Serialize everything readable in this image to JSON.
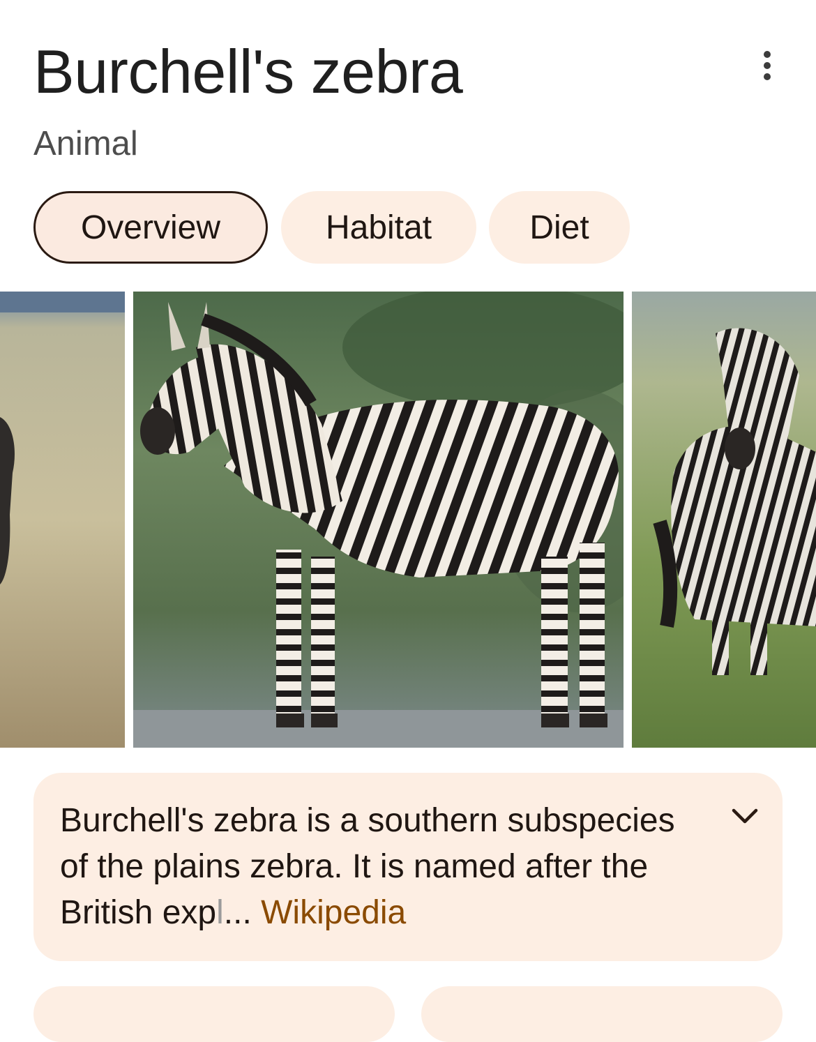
{
  "header": {
    "title": "Burchell's zebra",
    "subtitle": "Animal",
    "more_icon": "more-vert-icon"
  },
  "tabs": [
    {
      "label": "Overview",
      "active": true
    },
    {
      "label": "Habitat",
      "active": false
    },
    {
      "label": "Diet",
      "active": false
    }
  ],
  "gallery": {
    "images": [
      "zebra-grassland-photo",
      "zebra-standing-photo",
      "zebras-field-photo"
    ]
  },
  "description": {
    "text_main": "Burchell's zebra is a southern subspecies of the plains zebra. It is named after the British exp",
    "text_faded": "l",
    "ellipsis": "...",
    "source_link": "Wikipedia",
    "expand_icon": "chevron-down-icon"
  },
  "colors": {
    "chip_bg": "#fdeee3",
    "link": "#8a4a00",
    "text": "#1f1612"
  }
}
